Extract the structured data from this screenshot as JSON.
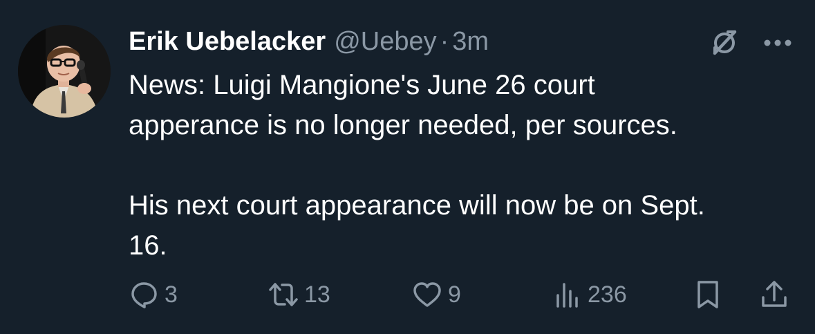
{
  "tweet": {
    "author_name": "Erik Uebelacker",
    "handle": "@Uebey",
    "separator": "·",
    "time": "3m",
    "text_lines": [
      "News: Luigi Mangione's June 26 court",
      "apperance is no longer needed, per sources.",
      "His next court appearance will now be on Sept.",
      "16."
    ]
  },
  "actions": {
    "replies": "3",
    "retweets": "13",
    "likes": "9",
    "views": "236"
  },
  "icons": {
    "avatar": "profile-photo",
    "grok": "grok-icon",
    "more": "more-icon",
    "reply": "reply-icon",
    "retweet": "retweet-icon",
    "like": "heart-icon",
    "views": "views-icon",
    "bookmark": "bookmark-icon",
    "share": "share-icon"
  },
  "colors": {
    "background": "#15202b",
    "text": "#ffffff",
    "muted": "#8b98a5"
  }
}
